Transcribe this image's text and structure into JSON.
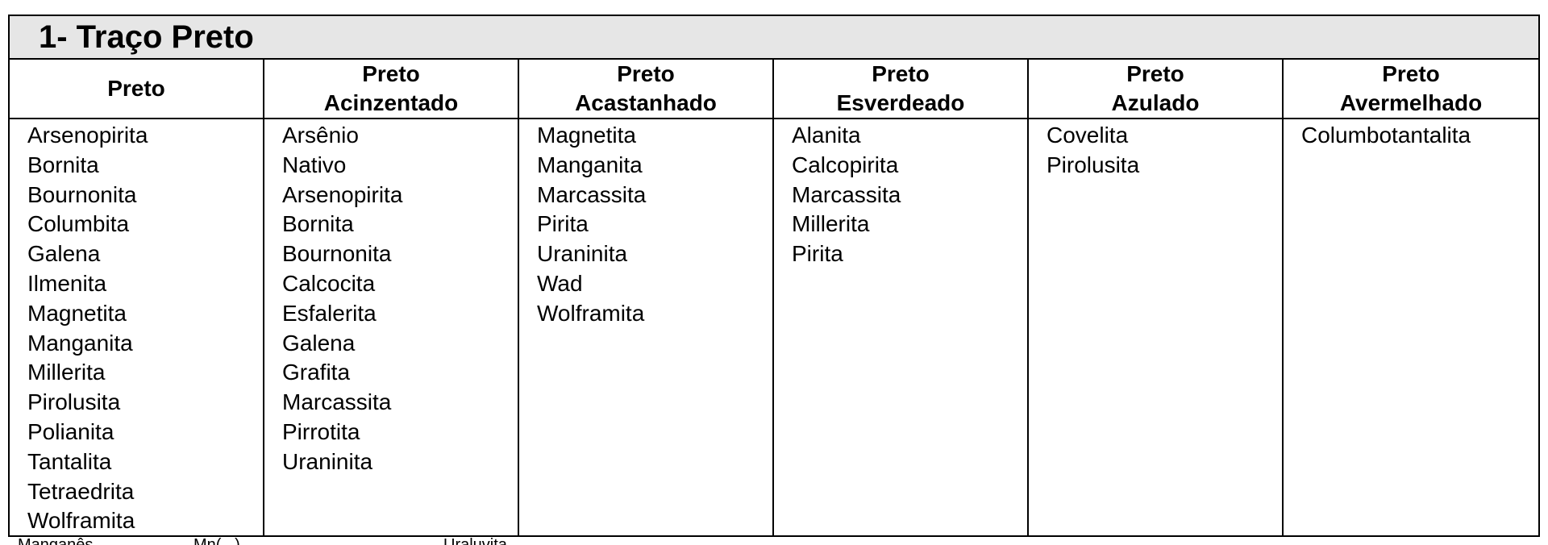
{
  "title": "1- Traço Preto",
  "columns": [
    {
      "header_lines": [
        "Preto"
      ],
      "minerals": [
        "Arsenopirita",
        "Bornita",
        "Bournonita",
        "Columbita",
        "Galena",
        "Ilmenita",
        "Magnetita",
        "Manganita",
        "Millerita",
        "Pirolusita",
        "Polianita",
        "Tantalita",
        "Tetraedrita",
        "Wolframita"
      ]
    },
    {
      "header_lines": [
        "Preto",
        "Acinzentado"
      ],
      "minerals": [
        "Arsênio",
        "Nativo",
        "Arsenopirita",
        "Bornita",
        "Bournonita",
        "Calcocita",
        "Esfalerita",
        "Galena",
        "Grafita",
        "Marcassita",
        "Pirrotita",
        "Uraninita"
      ]
    },
    {
      "header_lines": [
        "Preto",
        "Acastanhado"
      ],
      "minerals": [
        "Magnetita",
        "Manganita",
        "Marcassita",
        "Pirita",
        "Uraninita",
        "Wad",
        "Wolframita"
      ]
    },
    {
      "header_lines": [
        "Preto",
        "Esverdeado"
      ],
      "minerals": [
        "Alanita",
        "Calcopirita",
        "Marcassita",
        "Millerita",
        "Pirita"
      ]
    },
    {
      "header_lines": [
        "Preto",
        "Azulado"
      ],
      "minerals": [
        "Covelita",
        "Pirolusita"
      ]
    },
    {
      "header_lines": [
        "Preto",
        "Avermelhado"
      ],
      "minerals": [
        "Columbotantalita"
      ]
    }
  ],
  "footer": [
    "Manganês",
    "Mn(...)",
    "Uraluvita"
  ]
}
